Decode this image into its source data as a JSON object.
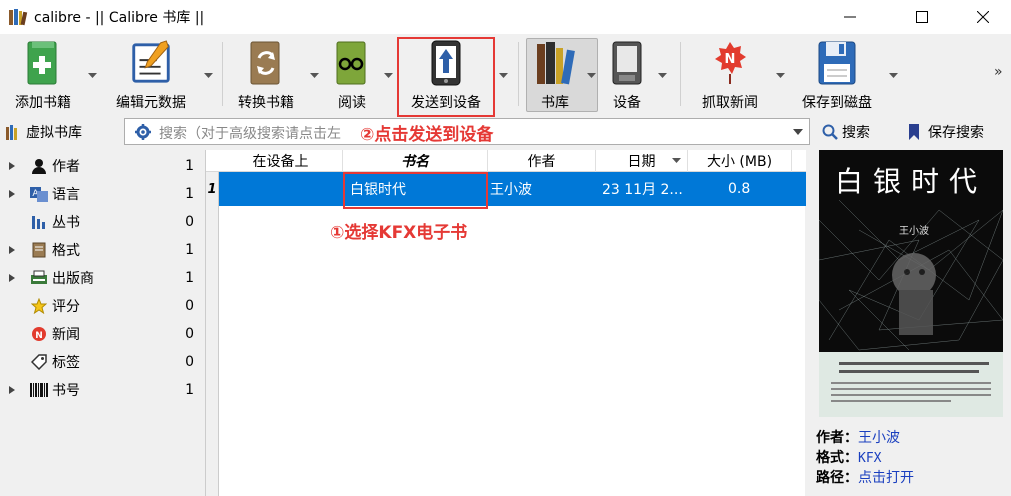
{
  "window": {
    "title": "calibre - || Calibre 书库 ||"
  },
  "toolbar": {
    "add": "添加书籍",
    "edit": "编辑元数据",
    "convert": "转换书籍",
    "read": "阅读",
    "send": "发送到设备",
    "library": "书库",
    "device": "设备",
    "news": "抓取新闻",
    "save": "保存到磁盘",
    "more": "»"
  },
  "searchbar": {
    "virtual_library": "虚拟书库",
    "placeholder": "搜索（对于高级搜索请点击左",
    "search_button": "搜索",
    "save_search": "保存搜索"
  },
  "tag_browser": [
    {
      "name": "作者",
      "count": "1",
      "icon": "person-icon"
    },
    {
      "name": "语言",
      "count": "1",
      "icon": "language-icon"
    },
    {
      "name": "丛书",
      "count": "0",
      "icon": "series-icon"
    },
    {
      "name": "格式",
      "count": "1",
      "icon": "format-icon"
    },
    {
      "name": "出版商",
      "count": "1",
      "icon": "publisher-icon"
    },
    {
      "name": "评分",
      "count": "0",
      "icon": "star-icon"
    },
    {
      "name": "新闻",
      "count": "0",
      "icon": "news-icon"
    },
    {
      "name": "标签",
      "count": "0",
      "icon": "tag-icon"
    },
    {
      "name": "书号",
      "count": "1",
      "icon": "barcode-icon"
    }
  ],
  "book_list": {
    "columns": [
      "在设备上",
      "书名",
      "作者",
      "日期",
      "大小 (MB)"
    ],
    "rows": [
      {
        "num": "1",
        "on_device": "",
        "title": "白银时代",
        "author": "王小波",
        "date": "23 11月 2...",
        "size": "0.8"
      }
    ]
  },
  "cover": {
    "title": "白银时代",
    "author": "王小波"
  },
  "details": {
    "author_label": "作者：",
    "author_value": "王小波",
    "format_label": "格式：",
    "format_value": "KFX",
    "path_label": "路径：",
    "path_value": "点击打开"
  },
  "annotations": {
    "step1": "①选择KFX电子书",
    "step2": "②点击发送到设备"
  },
  "colors": {
    "selection": "#0078d7",
    "annotation": "#e53935",
    "link": "#1a3fbf"
  }
}
